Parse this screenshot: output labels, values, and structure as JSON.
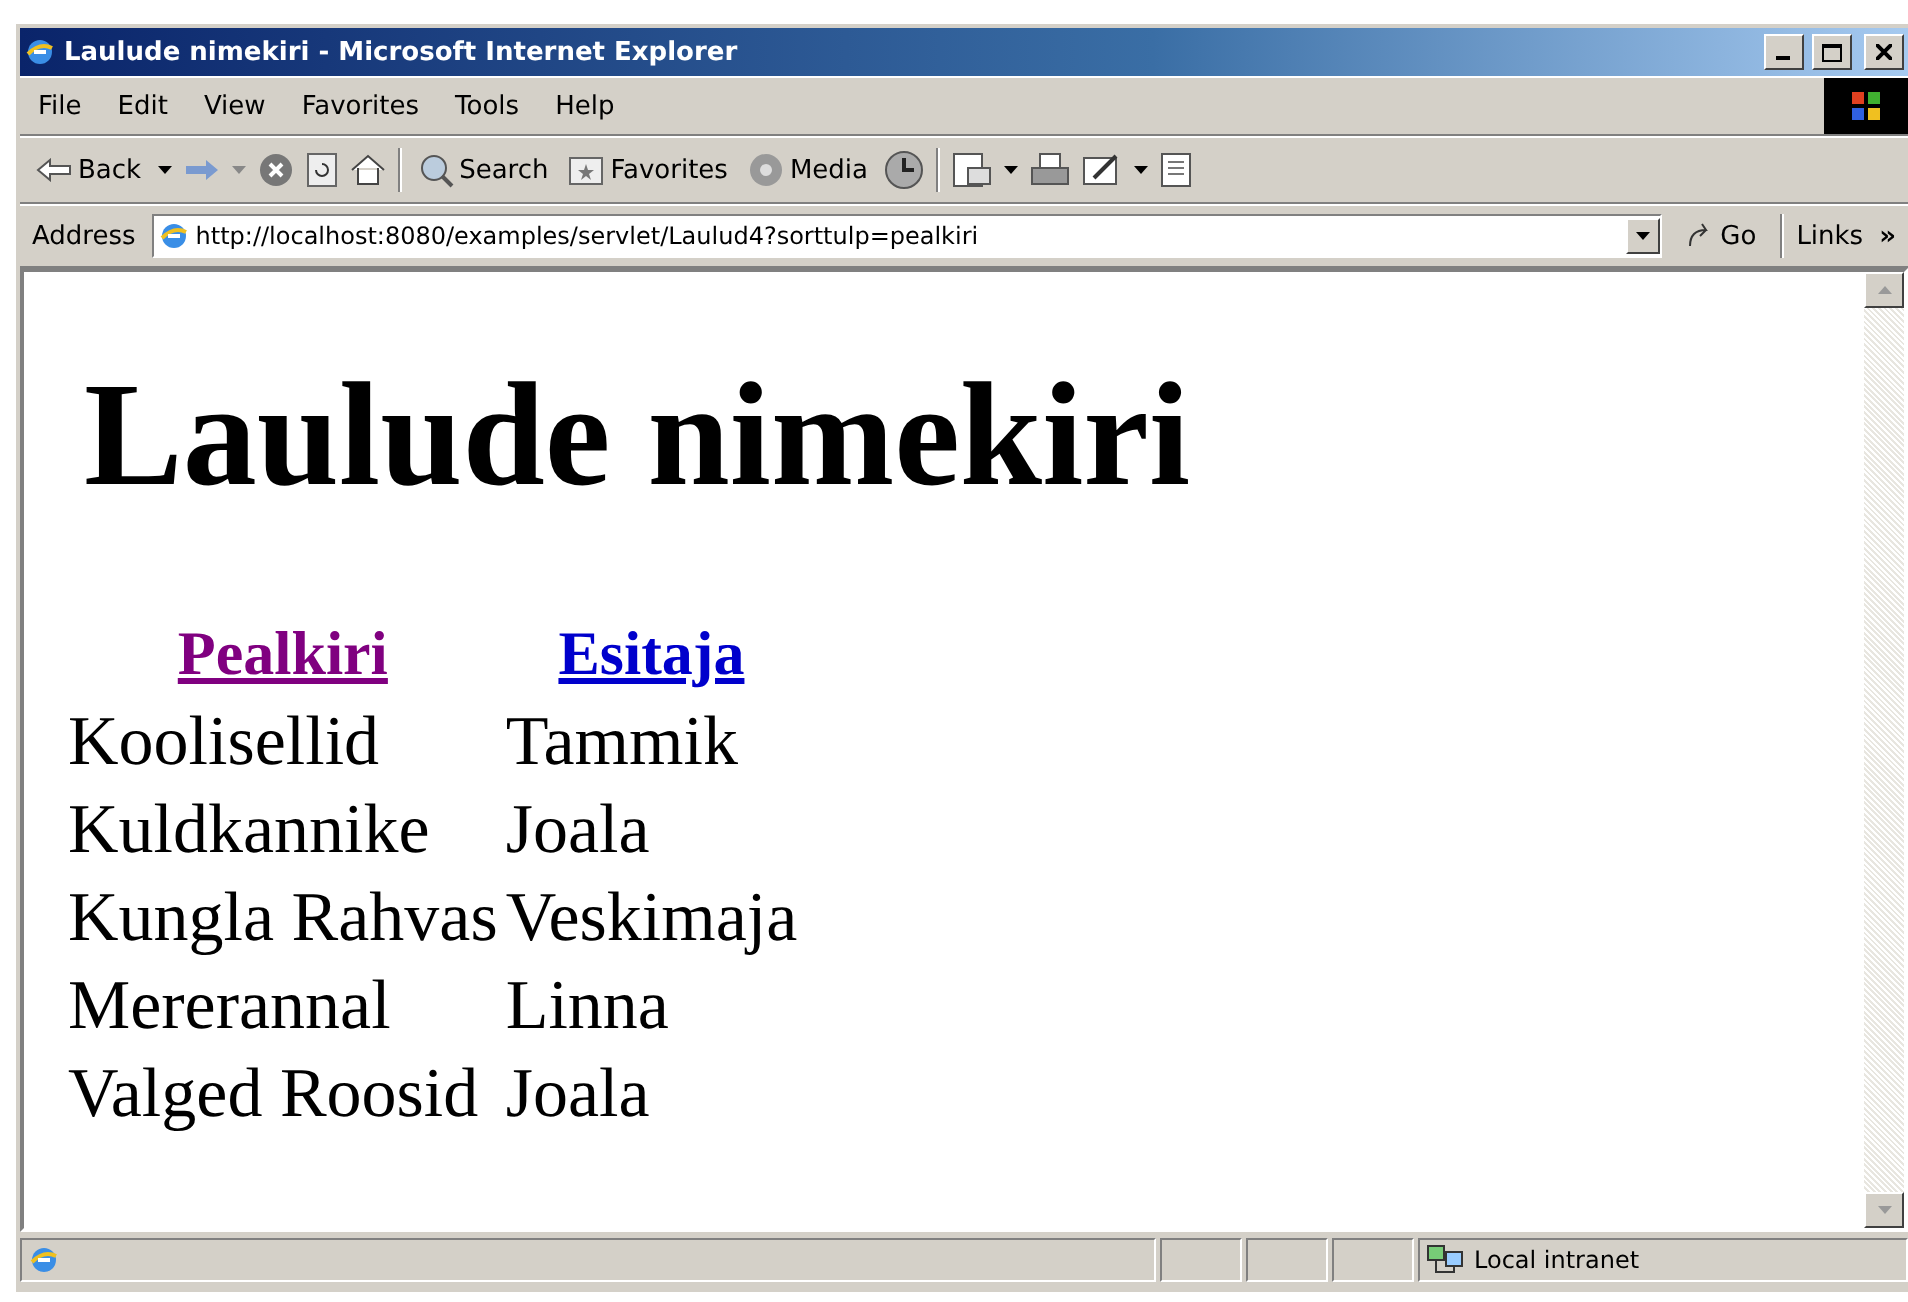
{
  "window": {
    "title": "Laulude nimekiri - Microsoft Internet Explorer"
  },
  "menu": [
    "File",
    "Edit",
    "View",
    "Favorites",
    "Tools",
    "Help"
  ],
  "toolbar": {
    "back": "Back",
    "search": "Search",
    "favorites": "Favorites",
    "media": "Media"
  },
  "address": {
    "label": "Address",
    "url": "http://localhost:8080/examples/servlet/Laulud4?sorttulp=pealkiri",
    "go": "Go",
    "links": "Links",
    "more": "»"
  },
  "page": {
    "heading": "Laulude nimekiri",
    "columns": [
      {
        "label": "Pealkiri",
        "visited": true
      },
      {
        "label": "Esitaja",
        "visited": false
      }
    ],
    "rows": [
      [
        "Koolisellid",
        "Tammik"
      ],
      [
        "Kuldkannike",
        "Joala"
      ],
      [
        "Kungla Rahvas",
        "Veskimaja"
      ],
      [
        "Mererannal",
        "Linna"
      ],
      [
        "Valged Roosid",
        "Joala"
      ]
    ]
  },
  "status_bar": {
    "zone": "Local intranet"
  }
}
